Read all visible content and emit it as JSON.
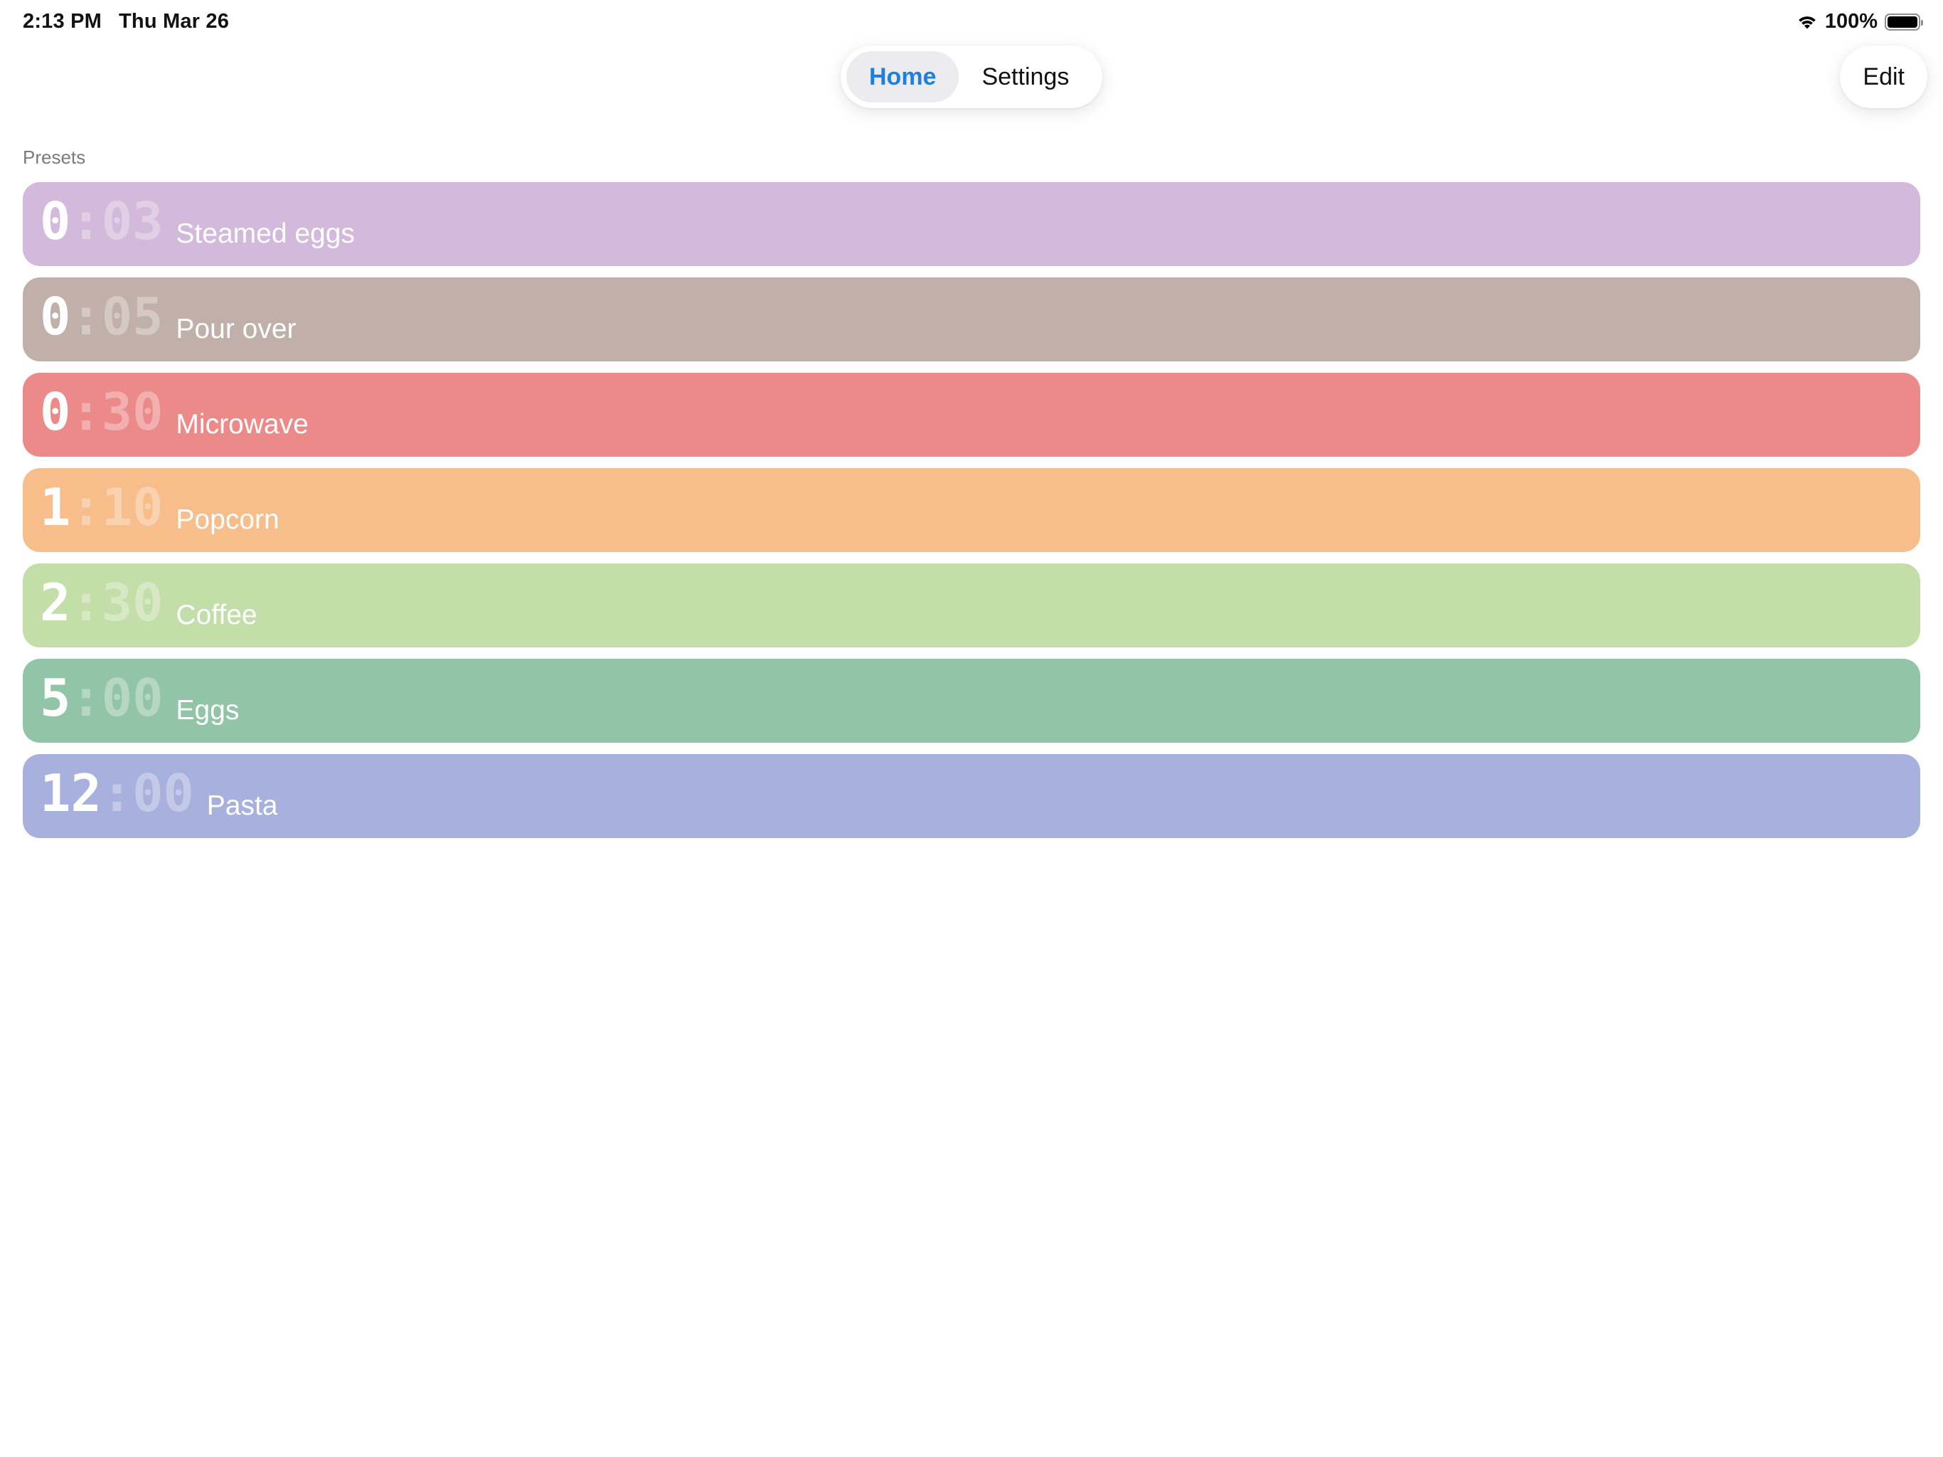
{
  "status_bar": {
    "time": "2:13 PM",
    "date": "Thu Mar 26",
    "battery": "100%"
  },
  "nav": {
    "tabs": [
      {
        "label": "Home",
        "active": true
      },
      {
        "label": "Settings",
        "active": false
      }
    ],
    "edit_label": "Edit"
  },
  "presets": {
    "section_label": "Presets",
    "items": [
      {
        "minutes": "0",
        "sep": ":",
        "seconds": "03",
        "name": "Steamed eggs",
        "color": "#d3b9db"
      },
      {
        "minutes": "0",
        "sep": ":",
        "seconds": "05",
        "name": "Pour over",
        "color": "#c0b0a9"
      },
      {
        "minutes": "0",
        "sep": ":",
        "seconds": "30",
        "name": "Microwave",
        "color": "#ec8a89"
      },
      {
        "minutes": "1",
        "sep": ":",
        "seconds": "10",
        "name": "Popcorn",
        "color": "#f7bd8b"
      },
      {
        "minutes": "2",
        "sep": ":",
        "seconds": "30",
        "name": "Coffee",
        "color": "#c3dea9"
      },
      {
        "minutes": "5",
        "sep": ":",
        "seconds": "00",
        "name": "Eggs",
        "color": "#92c5a8"
      },
      {
        "minutes": "12",
        "sep": ":",
        "seconds": "00",
        "name": "Pasta",
        "color": "#a8b0de"
      }
    ]
  },
  "icons": {
    "wifi": "wifi-icon",
    "battery": "battery-icon"
  }
}
